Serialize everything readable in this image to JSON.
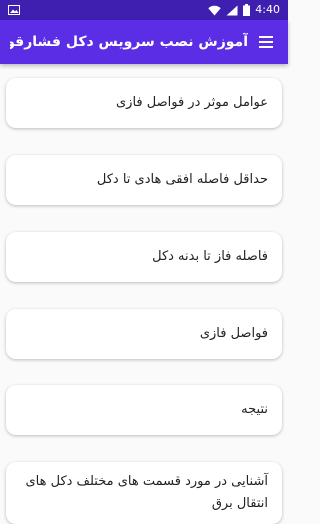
{
  "app": {
    "title": "آموزش نصب سرویس دکل فشارقوی"
  },
  "status_bar": {
    "time": "4:40"
  },
  "items": [
    {
      "label": "عوامل موثر در فواصل فازی"
    },
    {
      "label": "حداقل فاصله افقی هادی تا دکل"
    },
    {
      "label": "فاصله فاز تا بدنه دکل"
    },
    {
      "label": "فواصل فازی"
    },
    {
      "label": "نتیجه"
    },
    {
      "label": "آشنایی در مورد قسمت های مختلف دکل های انتقال برق"
    }
  ],
  "colors": {
    "status_bar": "#3e1fb0",
    "app_bar": "#5b2ee6",
    "background": "#fafafa",
    "card": "#ffffff"
  },
  "icons": {
    "status_left": "image-icon",
    "wifi": "wifi-icon",
    "signal": "signal-icon",
    "battery": "battery-icon",
    "menu": "hamburger-menu-icon"
  }
}
